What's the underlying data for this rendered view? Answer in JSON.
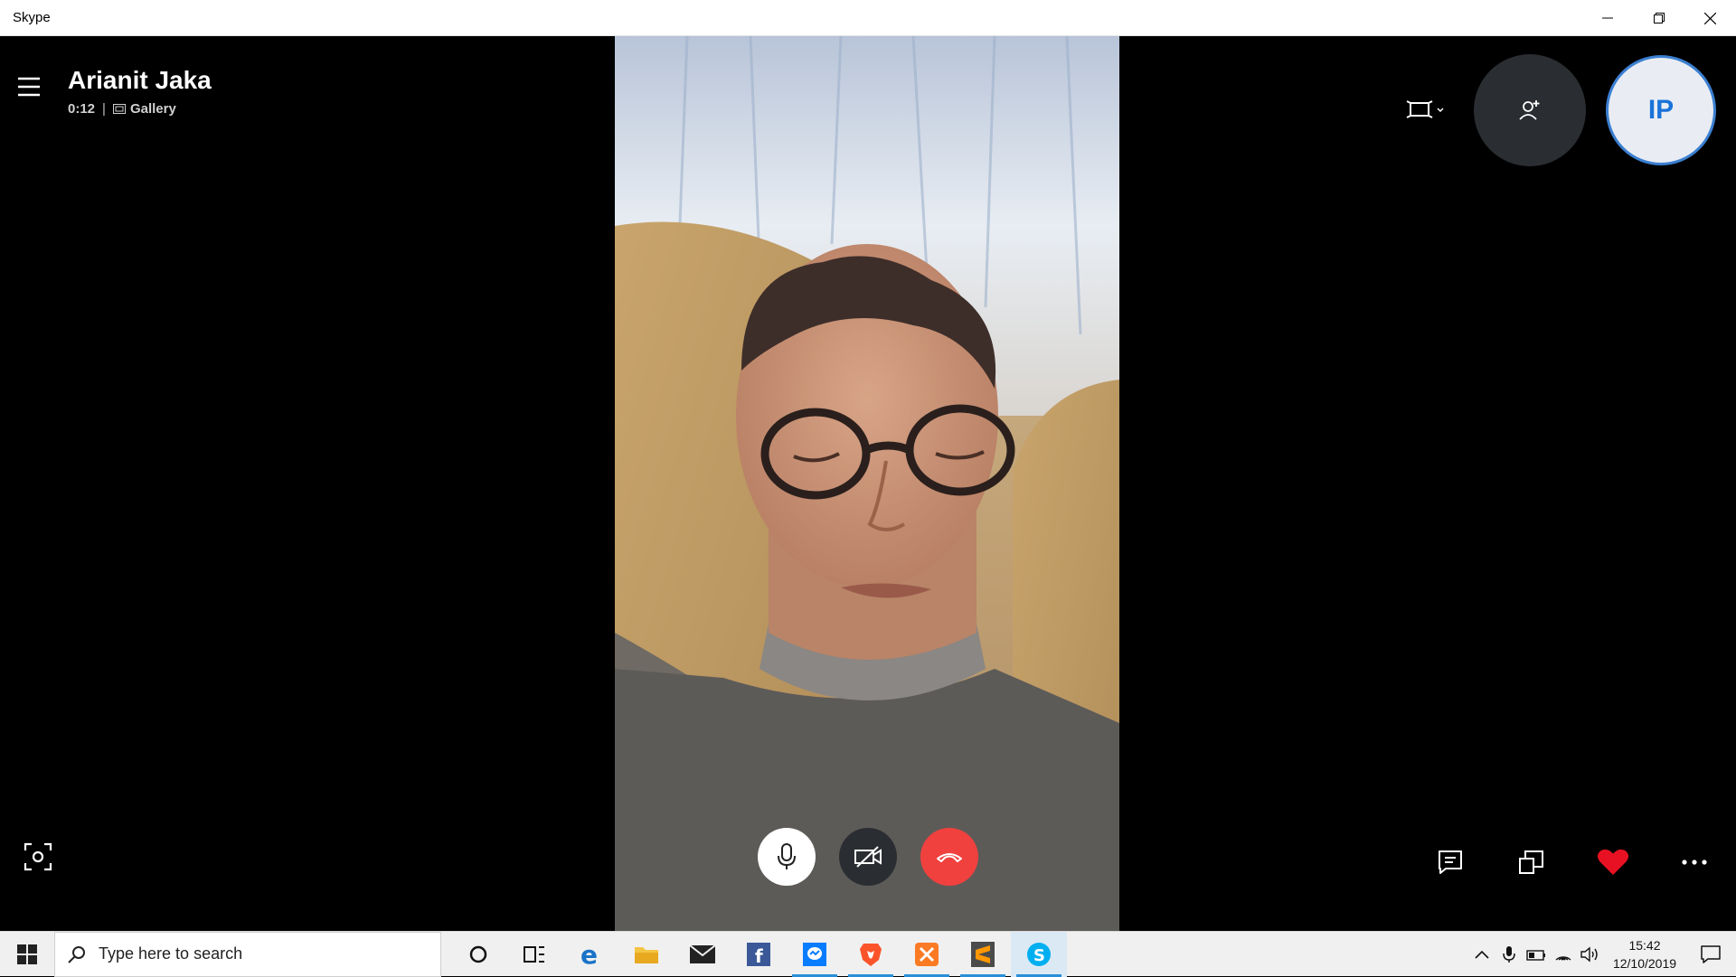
{
  "window": {
    "title": "Skype"
  },
  "call": {
    "contact_name": "Arianit Jaka",
    "duration": "0:12",
    "view_mode": "Gallery",
    "self_avatar_initials": "IP"
  },
  "icons": {
    "menu": "hamburger-icon",
    "gallery": "gallery-icon",
    "layout": "layout-icon",
    "add_person": "add-person-icon",
    "snapshot": "snapshot-icon",
    "mic": "microphone-icon",
    "camera_off": "camera-off-icon",
    "hang_up": "hang-up-icon",
    "chat": "chat-icon",
    "share_screen": "share-screen-icon",
    "react": "heart-icon",
    "more": "more-icon"
  },
  "colors": {
    "hang_up": "#f0413f",
    "accent_blue": "#1a73d9",
    "reaction": "#e81123"
  },
  "taskbar": {
    "search_placeholder": "Type here to search",
    "apps": [
      {
        "name": "cortana",
        "running": false
      },
      {
        "name": "task-view",
        "running": false
      },
      {
        "name": "edge",
        "running": false
      },
      {
        "name": "file-explorer",
        "running": false
      },
      {
        "name": "mail",
        "running": false
      },
      {
        "name": "facebook",
        "running": false
      },
      {
        "name": "messenger",
        "running": true
      },
      {
        "name": "brave",
        "running": true
      },
      {
        "name": "xampp",
        "running": true
      },
      {
        "name": "sublime-text",
        "running": true
      },
      {
        "name": "skype",
        "running": true
      }
    ],
    "clock_time": "15:42",
    "clock_date": "12/10/2019"
  }
}
